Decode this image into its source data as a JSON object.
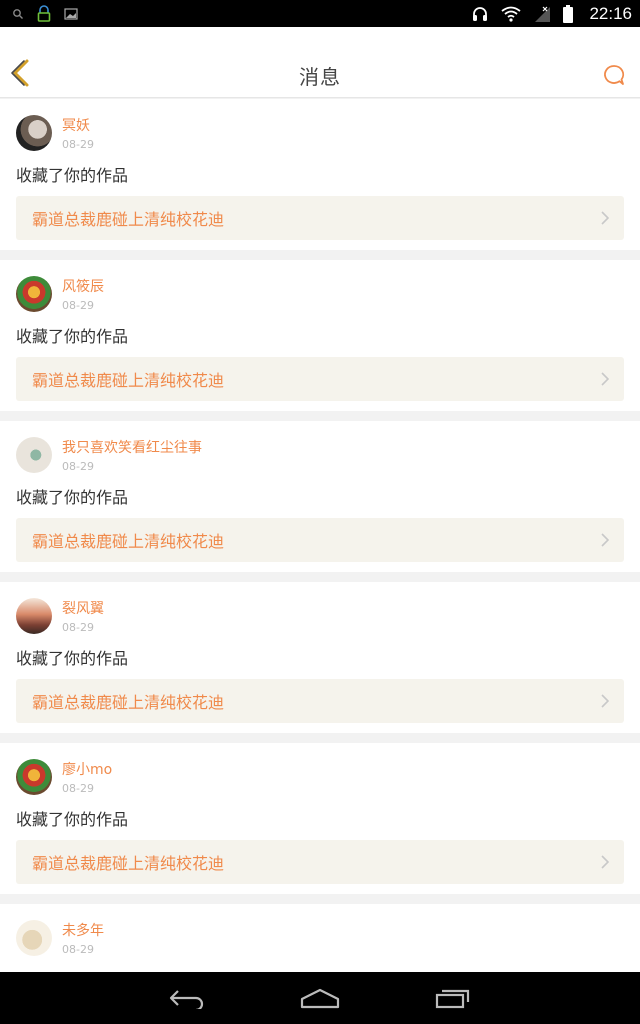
{
  "status_bar": {
    "time": "22:16",
    "icons": [
      "search-icon",
      "notification-icon",
      "image-icon",
      "headphones-icon",
      "wifi-icon",
      "signal-icon",
      "battery-icon"
    ]
  },
  "header": {
    "title": "消息",
    "back_icon": "chevron-left-icon",
    "action_icon": "chat-bubble-icon"
  },
  "messages": [
    {
      "username": "冥妖",
      "date": "08-29",
      "action": "收藏了你的作品",
      "work_title": "霸道总裁鹿碰上清纯校花迪"
    },
    {
      "username": "风筱辰",
      "date": "08-29",
      "action": "收藏了你的作品",
      "work_title": "霸道总裁鹿碰上清纯校花迪"
    },
    {
      "username": "我只喜欢笑看红尘往事",
      "date": "08-29",
      "action": "收藏了你的作品",
      "work_title": "霸道总裁鹿碰上清纯校花迪"
    },
    {
      "username": "裂风翼",
      "date": "08-29",
      "action": "收藏了你的作品",
      "work_title": "霸道总裁鹿碰上清纯校花迪"
    },
    {
      "username": "廖小mo",
      "date": "08-29",
      "action": "收藏了你的作品",
      "work_title": "霸道总裁鹿碰上清纯校花迪"
    },
    {
      "username": "未多年",
      "date": "08-29"
    }
  ],
  "colors": {
    "accent": "#f08a4b",
    "back_arrow": "#d3a12b",
    "link_bg": "#f5f3ec",
    "page_bg": "#f2f2f2"
  },
  "nav_bar": {
    "icons": [
      "back-icon",
      "home-icon",
      "recent-apps-icon"
    ]
  }
}
